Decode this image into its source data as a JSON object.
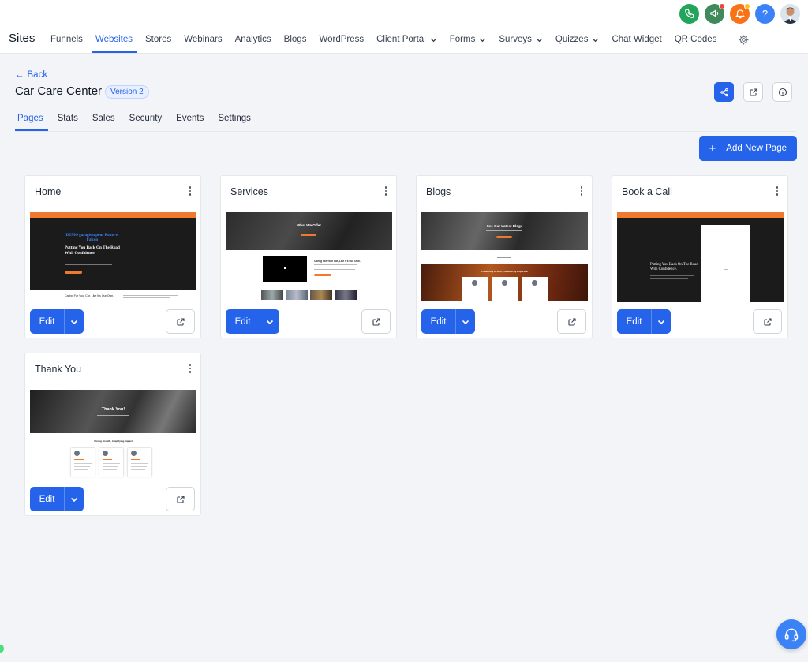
{
  "app": {
    "title": "Sites"
  },
  "nav": {
    "items": [
      {
        "label": "Funnels"
      },
      {
        "label": "Websites"
      },
      {
        "label": "Stores"
      },
      {
        "label": "Webinars"
      },
      {
        "label": "Analytics"
      },
      {
        "label": "Blogs"
      },
      {
        "label": "WordPress"
      },
      {
        "label": "Client Portal"
      },
      {
        "label": "Forms"
      },
      {
        "label": "Surveys"
      },
      {
        "label": "Quizzes"
      },
      {
        "label": "Chat Widget"
      },
      {
        "label": "QR Codes"
      }
    ],
    "active": "Websites"
  },
  "top_icons": [
    {
      "icon": "phone-icon",
      "color": "#22a55a"
    },
    {
      "icon": "megaphone-icon",
      "color": "#3f8a5b"
    },
    {
      "icon": "bell-icon",
      "color": "#f97316"
    },
    {
      "icon": "help-icon",
      "color": "#3b82f6",
      "glyph": "?"
    }
  ],
  "header": {
    "back_label": "Back",
    "site_title": "Car Care Center",
    "version": "Version 2"
  },
  "tabs": [
    {
      "label": "Pages"
    },
    {
      "label": "Stats"
    },
    {
      "label": "Sales"
    },
    {
      "label": "Security"
    },
    {
      "label": "Events"
    },
    {
      "label": "Settings"
    }
  ],
  "actions": {
    "add_page": "Add New Page"
  },
  "pages": [
    {
      "title": "Home",
      "edit_label": "Edit",
      "thumb": {
        "logo": "DEMO garagism pour Route et Falcon",
        "hero": "Putting You Back On The Road With Confidence.",
        "tagline": "Caring For Your Car, Like It's Our Own."
      }
    },
    {
      "title": "Services",
      "edit_label": "Edit",
      "thumb": {
        "hero": "What We Offer",
        "tagline": "Caring For Your Car, Like It's Our Own."
      }
    },
    {
      "title": "Blogs",
      "edit_label": "Edit",
      "thumb": {
        "hero": "See Our Latest Blogs",
        "section": "Powerfully Driven, Powered By Expertise"
      }
    },
    {
      "title": "Book a Call",
      "edit_label": "Edit",
      "thumb": {
        "hero": "Putting You Back On The Road With Confidence."
      }
    },
    {
      "title": "Thank You",
      "edit_label": "Edit",
      "thumb": {
        "hero": "Thank You!",
        "section": "Strong Growth, Amplifying Impact"
      }
    }
  ],
  "colors": {
    "accent": "#2563eb",
    "brand_orange": "#ef7a2f",
    "background": "#f2f4f7"
  }
}
